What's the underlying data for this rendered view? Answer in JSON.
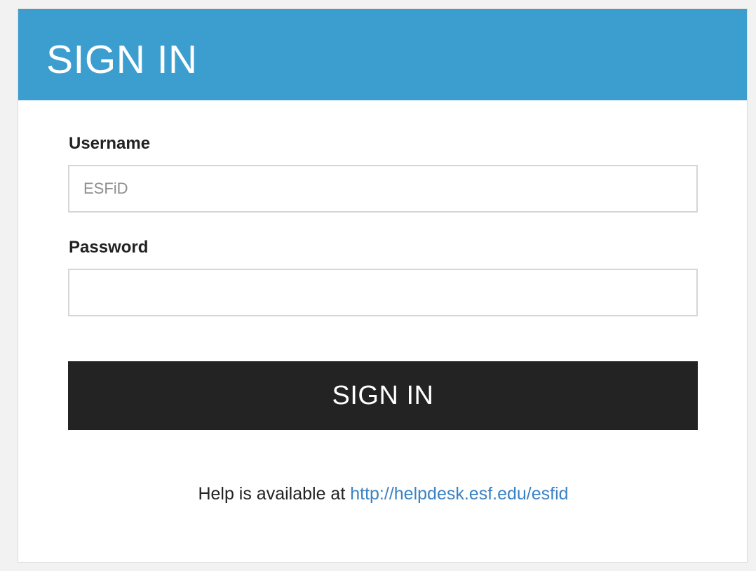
{
  "header": {
    "title": "SIGN IN"
  },
  "form": {
    "username_label": "Username",
    "username_placeholder": "ESFiD",
    "username_value": "",
    "password_label": "Password",
    "password_value": "",
    "submit_label": "SIGN IN"
  },
  "help": {
    "text": "Help is available at",
    "link_text": "http://helpdesk.esf.edu/esfid"
  },
  "colors": {
    "header_bg": "#3b9ecf",
    "button_bg": "#232323",
    "link": "#3b82c4"
  }
}
